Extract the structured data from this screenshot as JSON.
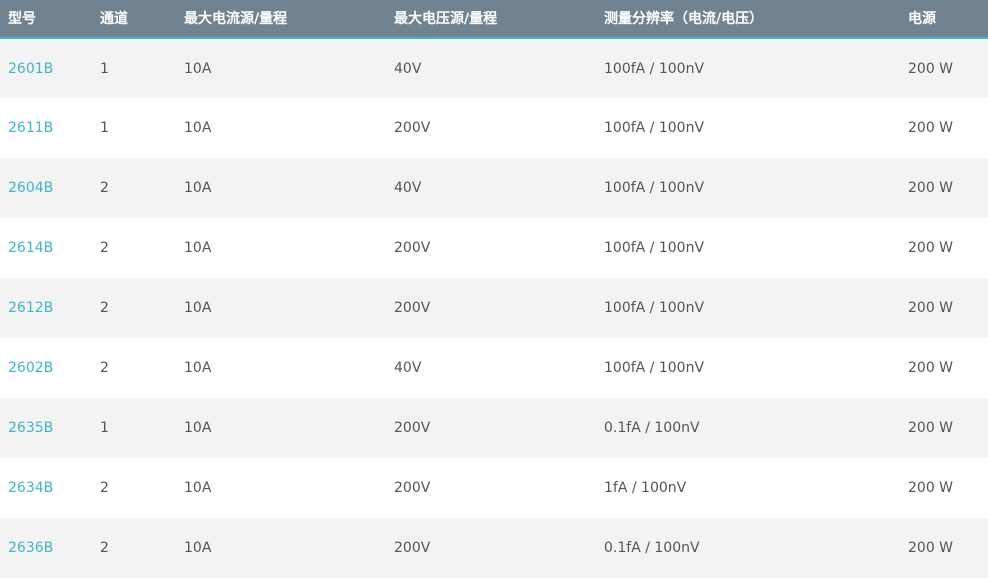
{
  "colors": {
    "header_bg": "#718390",
    "header_text": "#ffffff",
    "accent_link": "#3fb5c8",
    "row_alt_bg": "#f3f3f3",
    "row_bg": "#ffffff",
    "cell_text": "#555555"
  },
  "table": {
    "headers": [
      "型号",
      "通道",
      "最大电流源/量程",
      "最大电压源/量程",
      "测量分辨率（电流/电压）",
      "电源"
    ],
    "rows": [
      {
        "model": "2601B",
        "channels": "1",
        "max_current": "10A",
        "max_voltage": "40V",
        "resolution": "100fA / 100nV",
        "power": "200 W"
      },
      {
        "model": "2611B",
        "channels": "1",
        "max_current": "10A",
        "max_voltage": "200V",
        "resolution": "100fA / 100nV",
        "power": "200 W"
      },
      {
        "model": "2604B",
        "channels": "2",
        "max_current": "10A",
        "max_voltage": "40V",
        "resolution": "100fA / 100nV",
        "power": "200 W"
      },
      {
        "model": "2614B",
        "channels": "2",
        "max_current": "10A",
        "max_voltage": "200V",
        "resolution": "100fA / 100nV",
        "power": "200 W"
      },
      {
        "model": "2612B",
        "channels": "2",
        "max_current": "10A",
        "max_voltage": "200V",
        "resolution": "100fA / 100nV",
        "power": "200 W"
      },
      {
        "model": "2602B",
        "channels": "2",
        "max_current": "10A",
        "max_voltage": "40V",
        "resolution": "100fA / 100nV",
        "power": "200 W"
      },
      {
        "model": "2635B",
        "channels": "1",
        "max_current": "10A",
        "max_voltage": "200V",
        "resolution": "0.1fA / 100nV",
        "power": "200 W"
      },
      {
        "model": "2634B",
        "channels": "2",
        "max_current": "10A",
        "max_voltage": "200V",
        "resolution": "1fA / 100nV",
        "power": "200 W"
      },
      {
        "model": "2636B",
        "channels": "2",
        "max_current": "10A",
        "max_voltage": "200V",
        "resolution": "0.1fA / 100nV",
        "power": "200 W"
      }
    ]
  }
}
